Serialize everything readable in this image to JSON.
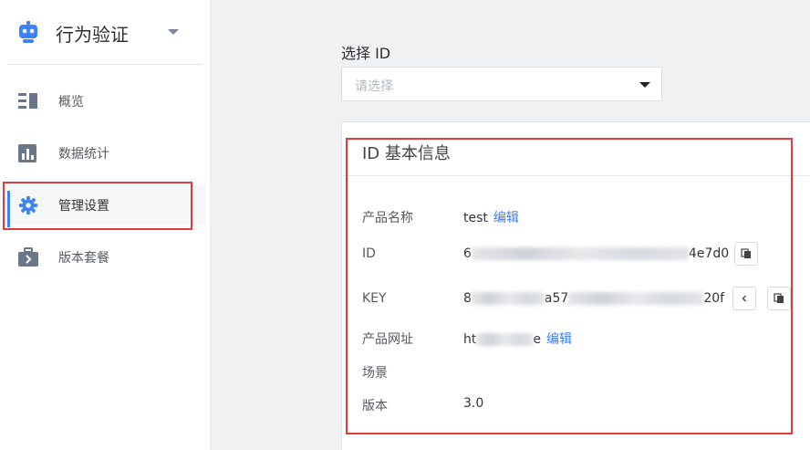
{
  "sidebar": {
    "brand": {
      "title": "行为验证",
      "icon": "robot-icon"
    },
    "items": [
      {
        "label": "概览",
        "icon": "list-columns-icon"
      },
      {
        "label": "数据统计",
        "icon": "bar-chart-icon"
      },
      {
        "label": "管理设置",
        "icon": "gear-icon",
        "active": true
      },
      {
        "label": "版本套餐",
        "icon": "briefcase-icon"
      }
    ]
  },
  "main": {
    "select": {
      "label": "选择 ID",
      "placeholder": "请选择"
    },
    "card": {
      "title": "ID 基本信息",
      "edit_label": "编辑",
      "rows": {
        "name": {
          "label": "产品名称",
          "value": "test"
        },
        "id": {
          "label": "ID",
          "prefix": "6",
          "suffix": "4e7d0"
        },
        "key": {
          "label": "KEY",
          "prefix": "8",
          "middle": "a57",
          "suffix": "20f"
        },
        "url": {
          "label": "产品网址",
          "prefix": "ht",
          "suffix": "e"
        },
        "scene": {
          "label": "场景",
          "value": ""
        },
        "version": {
          "label": "版本",
          "value": "3.0"
        }
      }
    }
  },
  "colors": {
    "accent": "#3b82f6",
    "link": "#3c7df0",
    "highlight": "#e23b3b"
  }
}
